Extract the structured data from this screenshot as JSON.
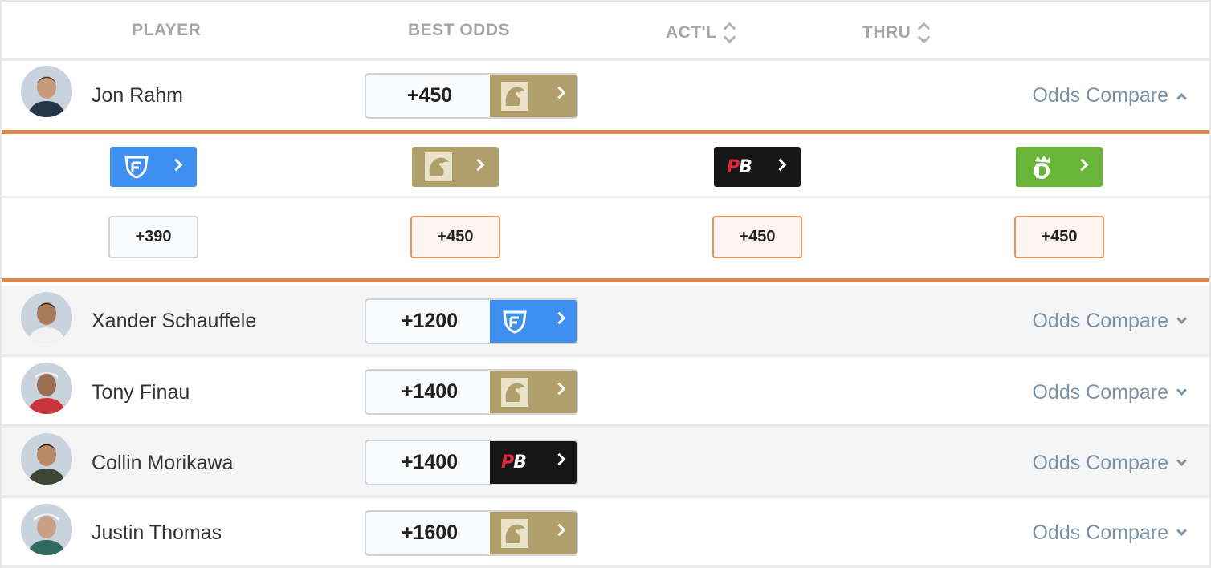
{
  "header": {
    "player": "PLAYER",
    "best_odds": "BEST ODDS",
    "actual": "ACT'L",
    "thru": "THRU"
  },
  "colors": {
    "accent_orange": "#d9874a",
    "compare_link": "#7a92a8",
    "mgm": "#b09f6b",
    "fanduel": "#3f8ff0",
    "pointsbet": "#161616",
    "draftkings": "#6bb43a"
  },
  "players": [
    {
      "name": "Jon Rahm",
      "best_odds": "+450",
      "book": "betmgm",
      "compare_label": "Odds Compare",
      "expanded": true
    },
    {
      "name": "Xander Schauffele",
      "best_odds": "+1200",
      "book": "fanduel",
      "compare_label": "Odds Compare",
      "expanded": false
    },
    {
      "name": "Tony Finau",
      "best_odds": "+1400",
      "book": "betmgm",
      "compare_label": "Odds Compare",
      "expanded": false
    },
    {
      "name": "Collin Morikawa",
      "best_odds": "+1400",
      "book": "pointsbet",
      "compare_label": "Odds Compare",
      "expanded": false
    },
    {
      "name": "Justin Thomas",
      "best_odds": "+1600",
      "book": "betmgm",
      "compare_label": "Odds Compare",
      "expanded": false
    }
  ],
  "compare_panel": {
    "books": [
      {
        "book": "fanduel",
        "odds": "+390",
        "best": false
      },
      {
        "book": "betmgm",
        "odds": "+450",
        "best": true
      },
      {
        "book": "pointsbet",
        "odds": "+450",
        "best": true
      },
      {
        "book": "draftkings",
        "odds": "+450",
        "best": true
      }
    ]
  },
  "icons": {
    "sort": "sort-updown-icon",
    "expand": "chevron-down-icon",
    "collapse": "chevron-up-icon",
    "go": "chevron-right-icon",
    "fanduel": "fanduel-shield-icon",
    "betmgm": "betmgm-lion-icon",
    "pointsbet": "pointsbet-pb-icon",
    "draftkings": "draftkings-crown-icon"
  }
}
